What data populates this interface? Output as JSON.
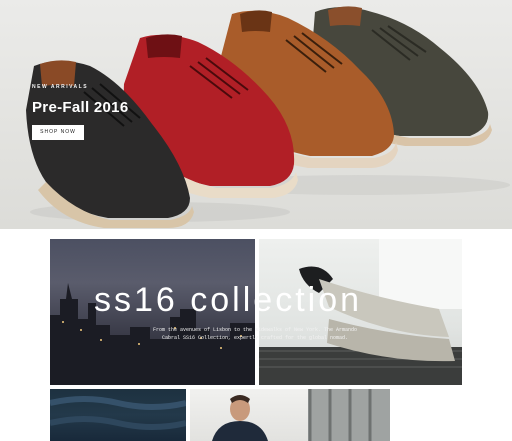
{
  "hero": {
    "eyebrow": "NEW ARRIVALS",
    "title": "Pre-Fall 2016",
    "cta_label": "SHOP NOW",
    "shoe_colors": [
      "#2b2a2a",
      "#b11f26",
      "#a95c2a",
      "#47473d"
    ]
  },
  "collection": {
    "title": "ss16 collection",
    "description": "From the avenues of Lisbon to the sidewalks of New York. The Armando Cabral SS16 Collection, expertly crafted for the global nomad."
  },
  "tiles": [
    {
      "name": "city-skyline-image"
    },
    {
      "name": "legs-sneakers-image"
    },
    {
      "name": "denim-texture-image"
    },
    {
      "name": "model-portrait-image"
    }
  ]
}
